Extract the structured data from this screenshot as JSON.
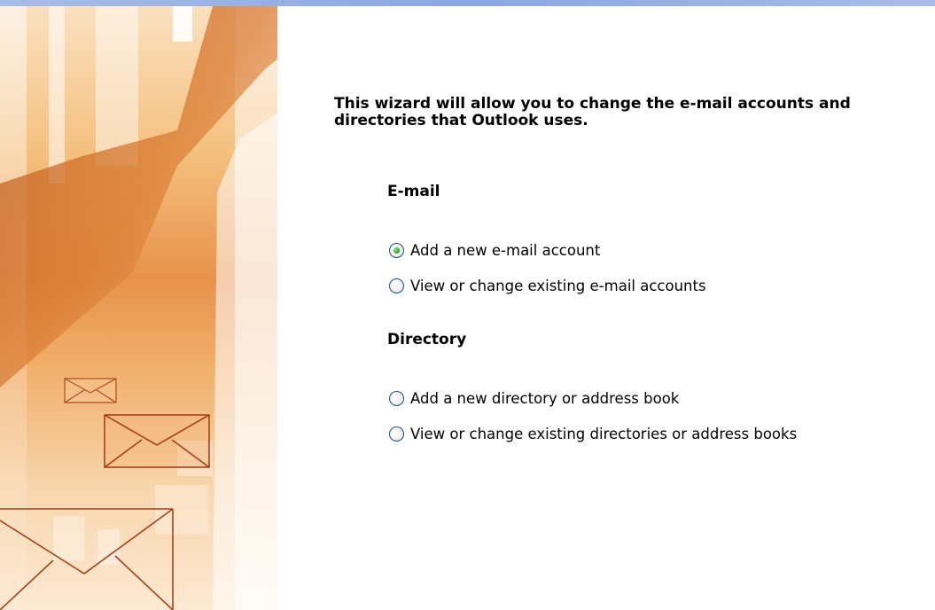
{
  "wizard": {
    "intro_text": "This wizard will allow you to change the e-mail accounts and directories that Outlook uses."
  },
  "email_group": {
    "heading": "E-mail",
    "options": [
      {
        "label": "Add a new e-mail account",
        "checked": true
      },
      {
        "label": "View or change existing e-mail accounts",
        "checked": false
      }
    ]
  },
  "directory_group": {
    "heading": "Directory",
    "options": [
      {
        "label": "Add a new directory or address book",
        "checked": false
      },
      {
        "label": "View or change existing directories or address books",
        "checked": false
      }
    ]
  },
  "colors": {
    "banner_orange": "#e7924b",
    "banner_light": "#fde9d2",
    "titlebar_blue": "#8aa7e2",
    "radio_border": "#1c5180",
    "radio_dot": "#3dae3d"
  },
  "icons": {
    "banner": "envelope-icon"
  }
}
